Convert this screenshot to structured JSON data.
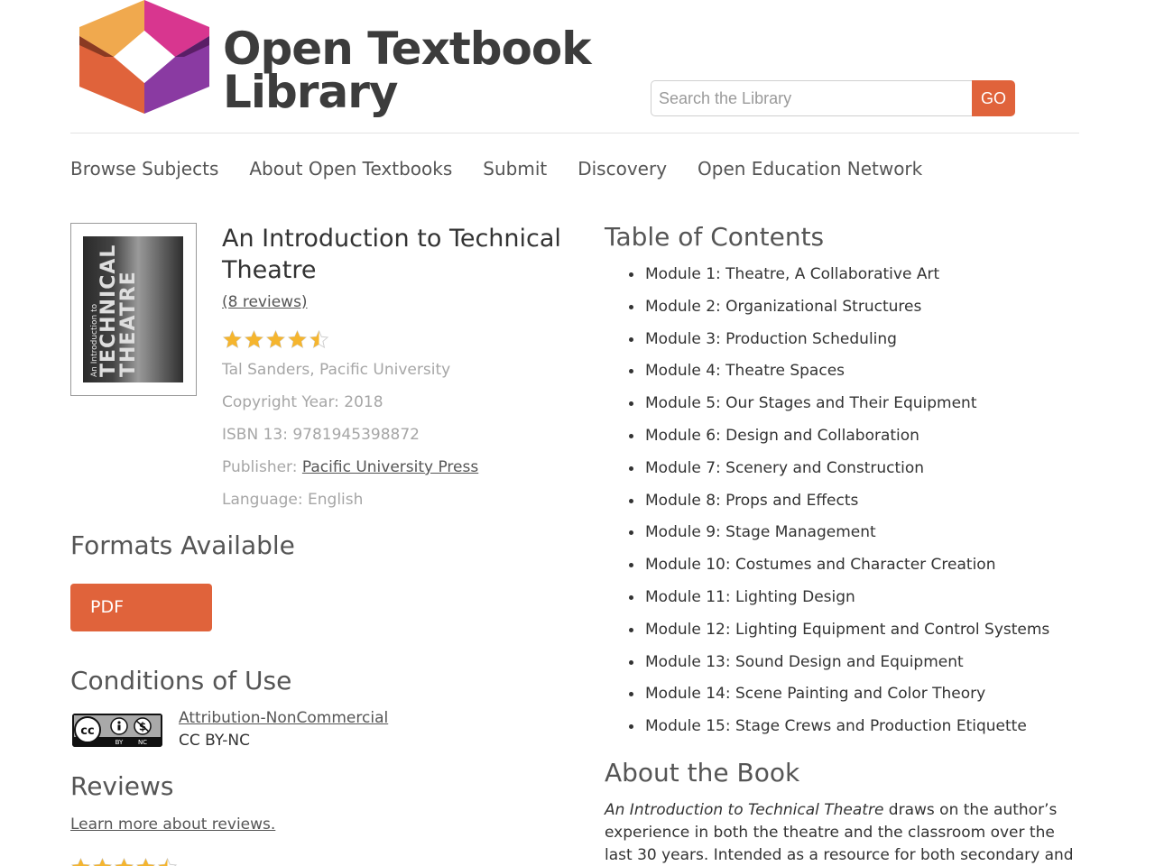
{
  "header": {
    "logo_line1": "Open Textbook",
    "logo_line2": "Library",
    "search_placeholder": "Search the Library",
    "search_button": "GO"
  },
  "nav": [
    {
      "label": "Browse Subjects"
    },
    {
      "label": "About Open Textbooks"
    },
    {
      "label": "Submit"
    },
    {
      "label": "Discovery"
    },
    {
      "label": "Open Education Network"
    }
  ],
  "book": {
    "cover_small": "An Introduction to",
    "cover_big1": "TECHNICAL",
    "cover_big2": "THEATRE",
    "title": "An Introduction to Technical Theatre",
    "reviews_link": "(8 reviews)",
    "rating": 4.5,
    "rating_max": 5,
    "author": "Tal Sanders, Pacific University",
    "copyright": "Copyright Year: 2018",
    "isbn": "ISBN 13: 9781945398872",
    "publisher_label": "Publisher: ",
    "publisher_name": "Pacific University Press",
    "language": "Language: English"
  },
  "formats": {
    "heading": "Formats Available",
    "pdf": "PDF"
  },
  "conditions": {
    "heading": "Conditions of Use",
    "license_link": "Attribution-NonCommercial",
    "license_short": "CC BY-NC"
  },
  "reviews": {
    "heading": "Reviews",
    "learn_more": "Learn more about reviews."
  },
  "toc": {
    "heading": "Table of Contents",
    "items": [
      "Module 1: Theatre, A Collaborative Art",
      "Module 2: Organizational Structures",
      "Module 3: Production Scheduling",
      "Module 4: Theatre Spaces",
      "Module 5: Our Stages and Their Equipment",
      "Module 6: Design and Collaboration",
      "Module 7: Scenery and Construction",
      "Module 8: Props and Effects",
      "Module 9: Stage Management",
      "Module 10: Costumes and Character Creation",
      "Module 11: Lighting Design",
      "Module 12: Lighting Equipment and Control Systems",
      "Module 13: Sound Design and Equipment",
      "Module 14: Scene Painting and Color Theory",
      "Module 15: Stage Crews and Production Etiquette"
    ]
  },
  "about": {
    "heading": "About the Book",
    "title_italic": "An Introduction to Technical Theatre",
    "text": " draws on the author’s experience in both the theatre and the classroom over the last 30 years. Intended as a resource for both secondary and post-"
  },
  "colors": {
    "accent": "#e0633b",
    "text": "#333333",
    "muted": "#a6a6a6",
    "star": "#f5b52e"
  }
}
